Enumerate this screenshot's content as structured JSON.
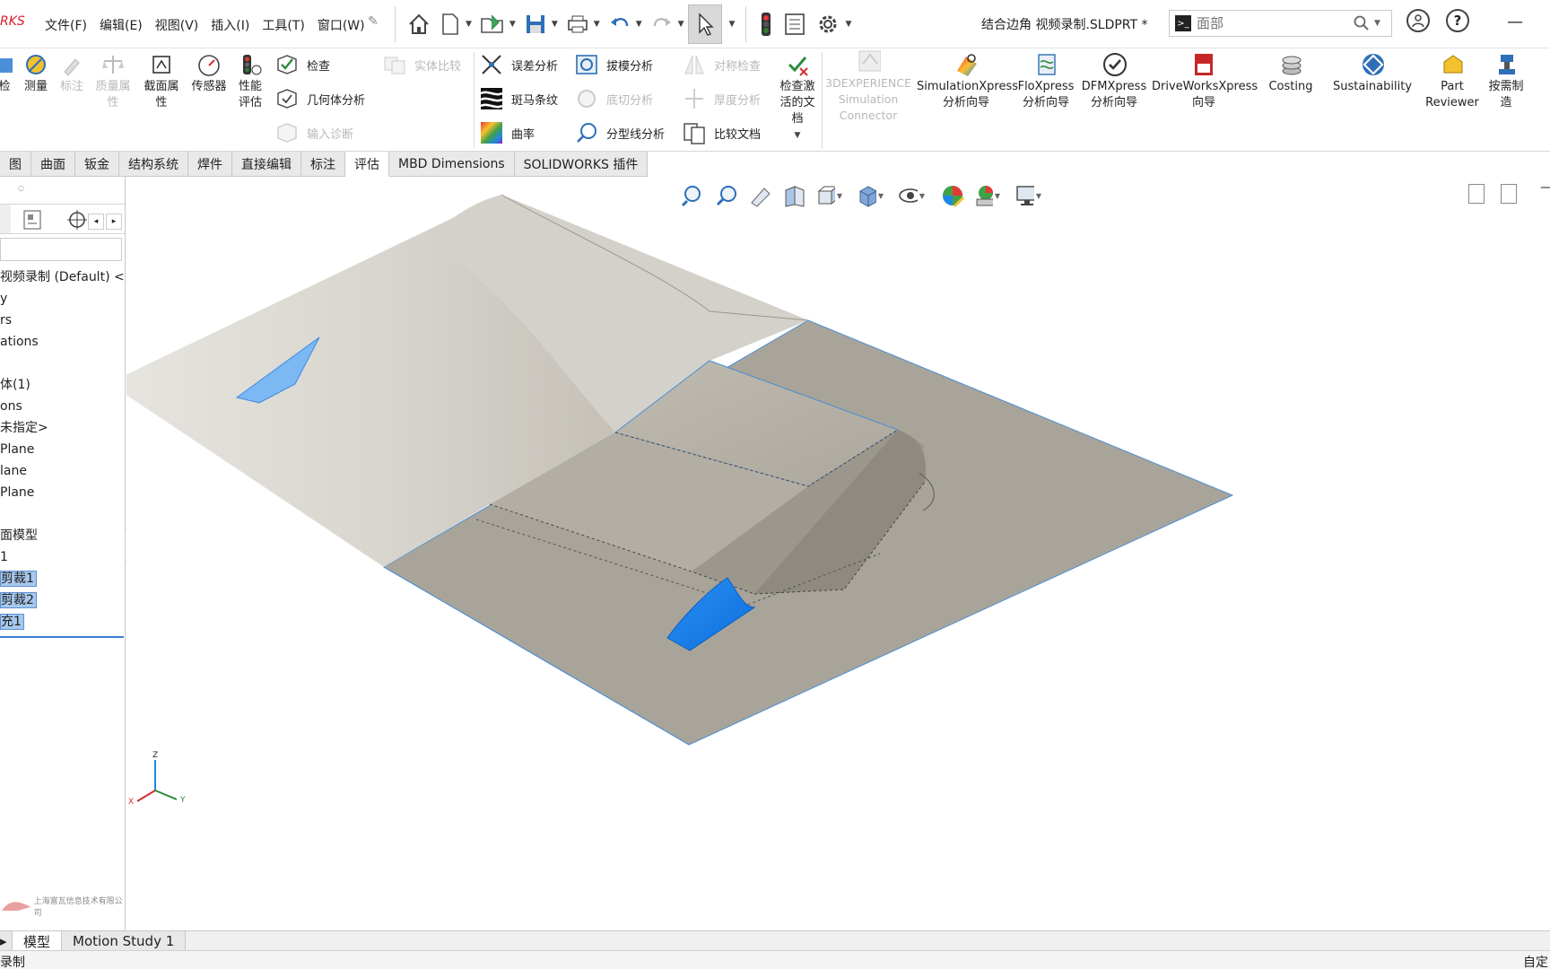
{
  "app": {
    "logo": "RKS",
    "title": "结合边角 视频录制.SLDPRT *"
  },
  "menu": [
    "文件(F)",
    "编辑(E)",
    "视图(V)",
    "插入(I)",
    "工具(T)",
    "窗口(W)"
  ],
  "search": {
    "placeholder": "面部"
  },
  "ribbon": {
    "group1": [
      {
        "label": "检",
        "icon": "check-icon"
      },
      {
        "label": "测量",
        "icon": "measure-icon"
      },
      {
        "label": "标注",
        "icon": "annotate-icon",
        "disabled": true
      },
      {
        "label": "质量属性",
        "icon": "mass-properties-icon",
        "disabled": true
      },
      {
        "label": "截面属性",
        "icon": "section-properties-icon"
      },
      {
        "label": "传感器",
        "icon": "sensor-icon"
      },
      {
        "label": "性能评估",
        "icon": "performance-icon"
      }
    ],
    "small1": [
      {
        "label": "检查",
        "icon": "check-entity-icon"
      },
      {
        "label": "几何体分析",
        "icon": "geometry-analysis-icon"
      },
      {
        "label": "输入诊断",
        "icon": "import-diagnostics-icon",
        "disabled": true
      }
    ],
    "compare": {
      "label": "实体比较",
      "disabled": true
    },
    "small2": [
      {
        "label": "误差分析",
        "icon": "deviation-analysis-icon"
      },
      {
        "label": "斑马条纹",
        "icon": "zebra-stripes-icon"
      },
      {
        "label": "曲率",
        "icon": "curvature-icon"
      }
    ],
    "small3": [
      {
        "label": "拔模分析",
        "icon": "draft-analysis-icon"
      },
      {
        "label": "底切分析",
        "icon": "undercut-analysis-icon",
        "disabled": true
      },
      {
        "label": "分型线分析",
        "icon": "parting-line-icon"
      }
    ],
    "small4": [
      {
        "label": "对称检查",
        "icon": "symmetry-check-icon",
        "disabled": true
      },
      {
        "label": "厚度分析",
        "icon": "thickness-analysis-icon",
        "disabled": true
      },
      {
        "label": "比较文档",
        "icon": "compare-documents-icon"
      }
    ],
    "check_active": "检查激活的文档",
    "addins": [
      {
        "label": "3DEXPERIENCE Simulation Connector",
        "disabled": true
      },
      {
        "label": "SimulationXpress 分析向导"
      },
      {
        "label": "FloXpress 分析向导"
      },
      {
        "label": "DFMXpress 分析向导"
      },
      {
        "label": "DriveWorksXpress 向导"
      },
      {
        "label": "Costing"
      },
      {
        "label": "Sustainability"
      },
      {
        "label": "Part Reviewer"
      },
      {
        "label": "按需制造"
      }
    ]
  },
  "tabs": [
    "图",
    "曲面",
    "钣金",
    "结构系统",
    "焊件",
    "直接编辑",
    "标注",
    "评估",
    "MBD Dimensions",
    "SOLIDWORKS 插件"
  ],
  "active_tab": "评估",
  "tree": [
    {
      "label": "视频录制 (Default) <"
    },
    {
      "label": "y"
    },
    {
      "label": "rs"
    },
    {
      "label": "ations"
    },
    {
      "label": ""
    },
    {
      "label": "体(1)"
    },
    {
      "label": "ons"
    },
    {
      "label": "未指定>"
    },
    {
      "label": "Plane"
    },
    {
      "label": "lane"
    },
    {
      "label": "Plane"
    },
    {
      "label": ""
    },
    {
      "label": "面模型"
    },
    {
      "label": "1"
    },
    {
      "label": "剪裁1",
      "highlight": true
    },
    {
      "label": "剪裁2",
      "highlight": true
    },
    {
      "label": "充1",
      "highlight": true
    }
  ],
  "triad": {
    "x": "X",
    "y": "Y",
    "z": "Z"
  },
  "watermark": "上海富瓦信息技术有限公司",
  "bottom_tabs": [
    "模型",
    "Motion Study 1"
  ],
  "status": {
    "left": "录制",
    "right": "自定"
  },
  "colors": {
    "accent": "#3b7fd4",
    "selection": "#1e88f0",
    "face_gray": "#a9a49a",
    "surface_light": "#dcdad4"
  }
}
